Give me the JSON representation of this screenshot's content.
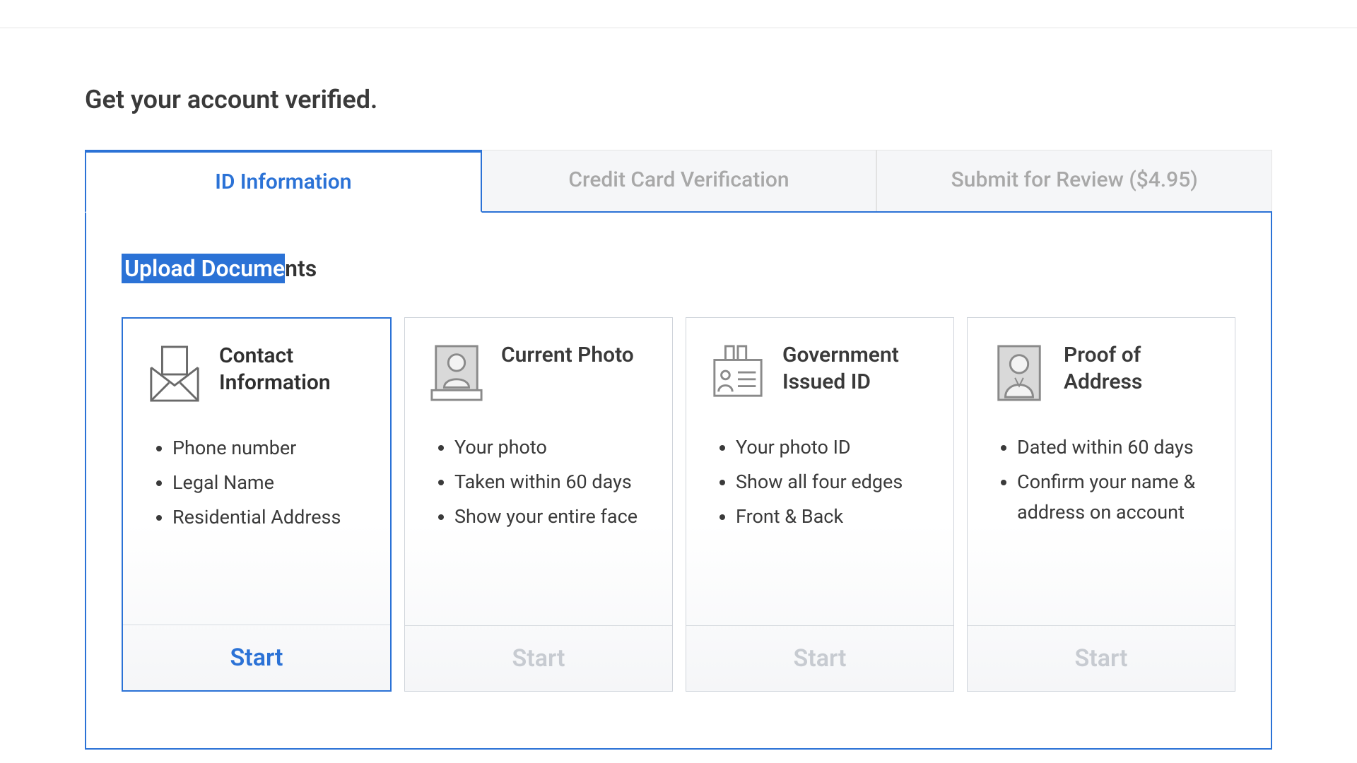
{
  "page": {
    "title": "Get your account verified."
  },
  "tabs": {
    "id_info": "ID Information",
    "cc_verify": "Credit Card Verification",
    "submit_review": "Submit for Review ($4.95)"
  },
  "section": {
    "title_highlight": "Upload Docume",
    "title_rest": "nts"
  },
  "cards": [
    {
      "title": "Contact Information",
      "items": [
        "Phone number",
        "Legal Name",
        "Residential Address"
      ],
      "button": "Start",
      "icon": "envelope-icon",
      "active": true
    },
    {
      "title": "Current Photo",
      "items": [
        "Your photo",
        "Taken within 60 days",
        "Show your entire face"
      ],
      "button": "Start",
      "icon": "photo-portrait-icon",
      "active": false
    },
    {
      "title": "Government Issued ID",
      "items": [
        "Your photo ID",
        "Show all four edges",
        "Front & Back"
      ],
      "button": "Start",
      "icon": "id-card-icon",
      "active": false
    },
    {
      "title": "Proof of Address",
      "items": [
        "Dated within 60 days",
        "Confirm your name & address on account"
      ],
      "button": "Start",
      "icon": "person-doc-icon",
      "active": false
    }
  ]
}
